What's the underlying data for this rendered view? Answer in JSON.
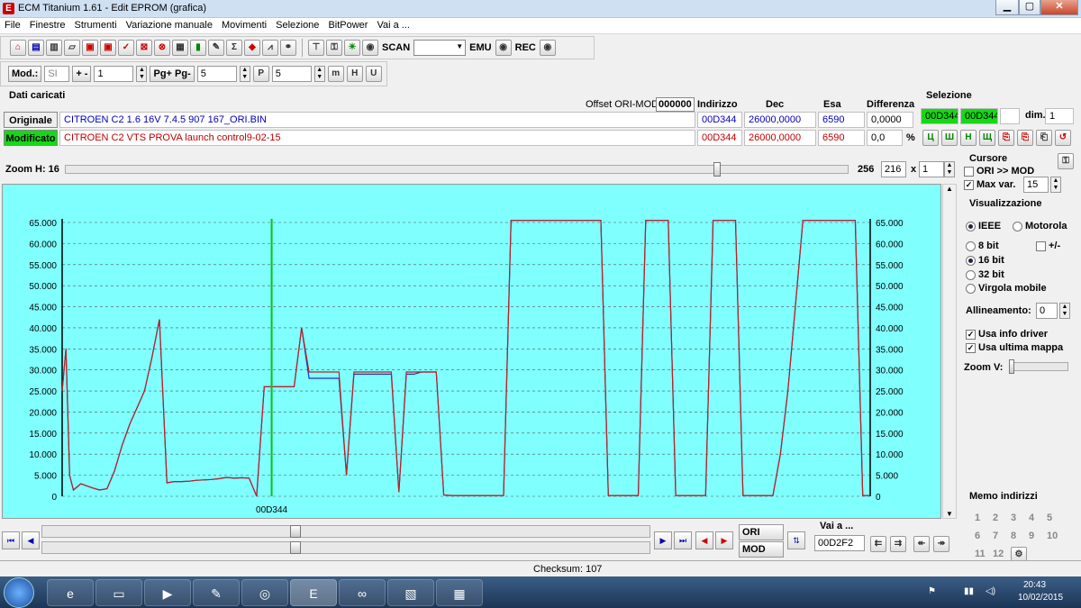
{
  "window": {
    "title": "ECM Titanium 1.61 - Edit EPROM (grafica)",
    "min": "▁",
    "max": "▢",
    "close": "✕"
  },
  "menu": [
    "File",
    "Finestre",
    "Strumenti",
    "Variazione manuale",
    "Movimenti",
    "Selezione",
    "BitPower",
    "Vai a ..."
  ],
  "toolbar": {
    "scan": "SCAN",
    "emu": "EMU",
    "rec": "REC"
  },
  "toolbar2": {
    "mod_label": "Mod.:",
    "mod_value": "SI",
    "plusminus": "+ -",
    "step_value": "1",
    "pg_label": "Pg+ Pg-",
    "pg_value": "5",
    "p_value": "5"
  },
  "dati": {
    "title": "Dati caricati",
    "offset_label": "Offset ORI-MOD",
    "offset_value": "000000",
    "h_indirizzo": "Indirizzo",
    "h_dec": "Dec",
    "h_esa": "Esa",
    "h_diff": "Differenza",
    "orig": {
      "label": "Originale",
      "file": "CITROEN C2 1.6 16V 7.4.5 907 167_ORI.BIN",
      "addr": "00D344",
      "dec": "26000,0000",
      "esa": "6590",
      "diff": "0,0000"
    },
    "mod": {
      "label": "Modificato",
      "file": "CITROEN C2 VTS PROVA launch control9-02-15",
      "addr": "00D344",
      "dec": "26000,0000",
      "esa": "6590",
      "diff": "0,0",
      "pct": "%"
    }
  },
  "selezione": {
    "title": "Selezione",
    "a": "00D344",
    "b": "00D344",
    "dim_label": "dim.",
    "dim_value": "1"
  },
  "zoom": {
    "label": "Zoom H: 16",
    "v1": "256",
    "v2": "216",
    "x": "x",
    "v3": "1"
  },
  "cursore": {
    "title": "Cursore",
    "ori_mod": "ORI >> MOD",
    "maxvar": "Max var.",
    "maxvar_value": "15"
  },
  "visual": {
    "title": "Visualizzazione",
    "ieee": "IEEE",
    "motorola": "Motorola",
    "b8": "8 bit",
    "pm": "+/-",
    "b16": "16 bit",
    "b32": "32 bit",
    "float": "Virgola mobile",
    "allin": "Allineamento:",
    "allin_value": "0",
    "usa_driver": "Usa info driver",
    "usa_mappa": "Usa ultima mappa",
    "zoomv": "Zoom V:"
  },
  "memo": {
    "title": "Memo indirizzi",
    "nums": [
      "1",
      "2",
      "3",
      "4",
      "5",
      "6",
      "7",
      "8",
      "9",
      "10",
      "11",
      "12"
    ]
  },
  "nav": {
    "ori": "ORI",
    "mod": "MOD",
    "vai": "Vai a ...",
    "vai_value": "00D2F2"
  },
  "status": {
    "checksum": "Checksum: 107"
  },
  "tray": {
    "time": "20:43",
    "date": "10/02/2015"
  },
  "colors": {
    "chart_bg": "#80ffff",
    "ori": "#2030c0",
    "mod": "#c02020",
    "cursor": "#10c010"
  },
  "chart_data": {
    "type": "line",
    "cursor_label": "00D344",
    "ylim": [
      0,
      65000
    ],
    "yticks": [
      "0",
      "5.000",
      "10.000",
      "15.000",
      "20.000",
      "25.000",
      "30.000",
      "35.000",
      "40.000",
      "45.000",
      "50.000",
      "55.000",
      "60.000",
      "65.000"
    ],
    "x": [
      0,
      1,
      2,
      3,
      5,
      8,
      10,
      12,
      14,
      16,
      18,
      20,
      22,
      24,
      26,
      28,
      30,
      32,
      34,
      36,
      38,
      40,
      42,
      44,
      46,
      48,
      50,
      52,
      54,
      56,
      58,
      60,
      62,
      64,
      66,
      68,
      70,
      72,
      74,
      76,
      78,
      80,
      82,
      84,
      86,
      88,
      90,
      92,
      94,
      96,
      98,
      100,
      102,
      104,
      106,
      108,
      110,
      112,
      114,
      116,
      118,
      120,
      122,
      124,
      126,
      128,
      130,
      132,
      134,
      136,
      138,
      140,
      142,
      144,
      146,
      148,
      150,
      152,
      154,
      156,
      158,
      160,
      162,
      164,
      166,
      168,
      170,
      172,
      174,
      176,
      178,
      180,
      182,
      184,
      186,
      188,
      190,
      192,
      194,
      196,
      198,
      200,
      202,
      204,
      206,
      208,
      210,
      212,
      214,
      216
    ],
    "series": [
      {
        "name": "Originale",
        "values": [
          25000,
          35000,
          5000,
          1500,
          3000,
          2000,
          1500,
          1800,
          6000,
          12000,
          17000,
          21000,
          25000,
          33000,
          42000,
          3200,
          3500,
          3500,
          3600,
          3800,
          3900,
          4000,
          4200,
          4500,
          4300,
          4400,
          4300,
          0,
          26000,
          26000,
          26000,
          26000,
          26000,
          40000,
          28000,
          28000,
          28000,
          28000,
          28000,
          5000,
          29000,
          29000,
          29000,
          29000,
          29000,
          29000,
          1000,
          29000,
          29000,
          29500,
          29500,
          29500,
          300,
          200,
          200,
          200,
          200,
          200,
          200,
          200,
          200,
          65500,
          65500,
          65500,
          65500,
          65500,
          65500,
          65500,
          65500,
          65500,
          65500,
          65500,
          65500,
          65500,
          200,
          200,
          200,
          200,
          200,
          65500,
          65500,
          65500,
          65500,
          200,
          200,
          200,
          200,
          200,
          65500,
          65500,
          65500,
          65500,
          200,
          200,
          200,
          200,
          200,
          10000,
          25000,
          45000,
          65500,
          65500,
          65500,
          65500,
          65500,
          65500,
          65500,
          65500,
          200,
          200,
          200,
          200,
          200,
          200,
          200,
          200
        ]
      },
      {
        "name": "Modificato",
        "values": [
          25000,
          35000,
          5000,
          1500,
          3000,
          2000,
          1500,
          1800,
          6000,
          12000,
          17000,
          21000,
          25000,
          33000,
          42000,
          3200,
          3500,
          3500,
          3600,
          3800,
          3900,
          4000,
          4200,
          4500,
          4300,
          4400,
          4300,
          0,
          26000,
          26000,
          26000,
          26000,
          26000,
          40000,
          29500,
          29500,
          29500,
          29500,
          29500,
          5000,
          29500,
          29500,
          29500,
          29500,
          29500,
          29500,
          1000,
          29500,
          29500,
          29500,
          29500,
          29500,
          300,
          200,
          200,
          200,
          200,
          200,
          200,
          200,
          200,
          65500,
          65500,
          65500,
          65500,
          65500,
          65500,
          65500,
          65500,
          65500,
          65500,
          65500,
          65500,
          65500,
          200,
          200,
          200,
          200,
          200,
          65500,
          65500,
          65500,
          65500,
          200,
          200,
          200,
          200,
          200,
          65500,
          65500,
          65500,
          65500,
          200,
          200,
          200,
          200,
          200,
          10000,
          25000,
          45000,
          65500,
          65500,
          65500,
          65500,
          65500,
          65500,
          65500,
          65500,
          200,
          200,
          200,
          200,
          200,
          200,
          200,
          200
        ]
      }
    ]
  }
}
